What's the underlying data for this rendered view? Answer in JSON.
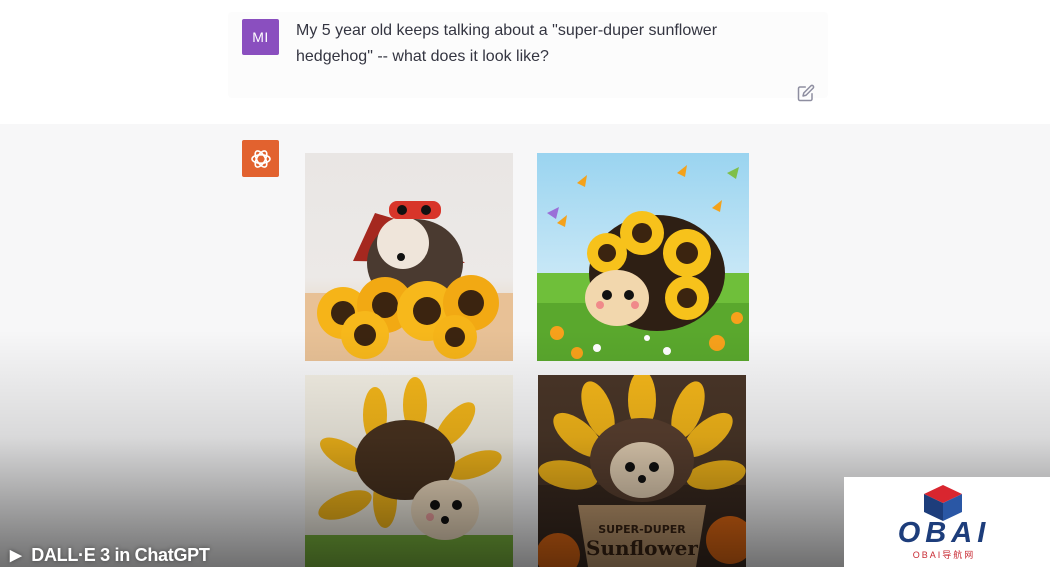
{
  "user_message": {
    "avatar_initials": "MI",
    "text": "My 5 year old keeps talking about a \"super-duper sunflower hedgehog\" -- what does it look like?"
  },
  "icons": {
    "edit": "edit-pencil-icon",
    "assistant_avatar": "openai-logo-icon",
    "play": "play-icon"
  },
  "assistant": {
    "images": [
      {
        "subject": "hedgehog with red mask and cape among sunflowers"
      },
      {
        "subject": "cartoon hedgehog with sunflower spines in flower meadow with butterflies"
      },
      {
        "subject": "illustrated hedgehog with sunflower petal spines"
      },
      {
        "subject": "hedgehog in sunflower in a pot",
        "pot_text_line1": "SUPER-DUPER",
        "pot_text_line2": "Sunflower"
      }
    ]
  },
  "video_caption": {
    "play_glyph": "▶",
    "title": "DALL·E 3 in ChatGPT"
  },
  "watermark": {
    "brand": "OBAI",
    "subtitle": "OBAI导航网"
  },
  "colors": {
    "user_avatar": "#8a4fbf",
    "assistant_avatar": "#e2622f",
    "assistant_bg": "#f7f7f8",
    "text": "#343541"
  }
}
